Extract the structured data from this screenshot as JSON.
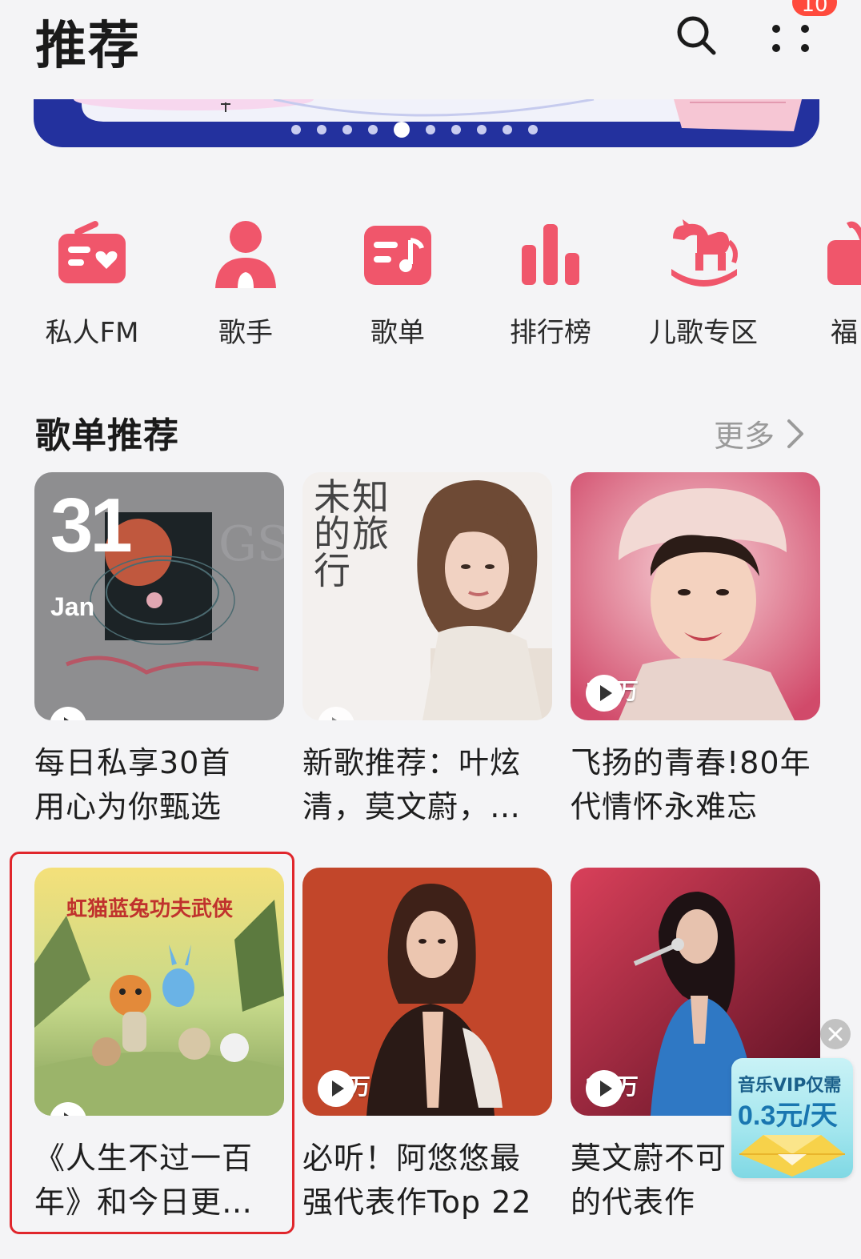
{
  "header": {
    "title": "推荐",
    "badge": "10"
  },
  "banner": {
    "dot_count": 10,
    "active_dot": 5
  },
  "categories": [
    {
      "label": "私人FM",
      "icon": "radio-icon"
    },
    {
      "label": "歌手",
      "icon": "singer-icon"
    },
    {
      "label": "歌单",
      "icon": "playlist-icon"
    },
    {
      "label": "排行榜",
      "icon": "chart-bars-icon"
    },
    {
      "label": "儿歌专区",
      "icon": "rocking-horse-icon"
    },
    {
      "label": "福",
      "icon": "gift-icon"
    }
  ],
  "section": {
    "title": "歌单推荐",
    "more": "更多"
  },
  "playlists": [
    {
      "title_line1": "每日私享30首",
      "title_line2": "用心为你甄选",
      "plays": "",
      "cover": {
        "day": "31",
        "month": "Jan"
      }
    },
    {
      "title_line1": "新歌推荐：叶炫",
      "title_line2": "清，莫文蔚，…",
      "plays": "",
      "cover": {
        "text": "未知的旅行"
      }
    },
    {
      "title_line1": "飞扬的青春!80年",
      "title_line2": "代情怀永难忘",
      "plays": "50万"
    },
    {
      "title_line1": "《人生不过一百",
      "title_line2": "年》和今日更…",
      "plays": ""
    },
    {
      "title_line1": "必听！阿悠悠最",
      "title_line2": "强代表作Top 22",
      "plays": "60万"
    },
    {
      "title_line1": "莫文蔚不可",
      "title_line2": "的代表作",
      "plays": "28万"
    }
  ],
  "vip_ad": {
    "line1": "音乐VIP仅需",
    "line2": "0.3元/天"
  },
  "colors": {
    "accent": "#f0566b",
    "highlight": "#e0262c",
    "banner": "#23319e"
  }
}
